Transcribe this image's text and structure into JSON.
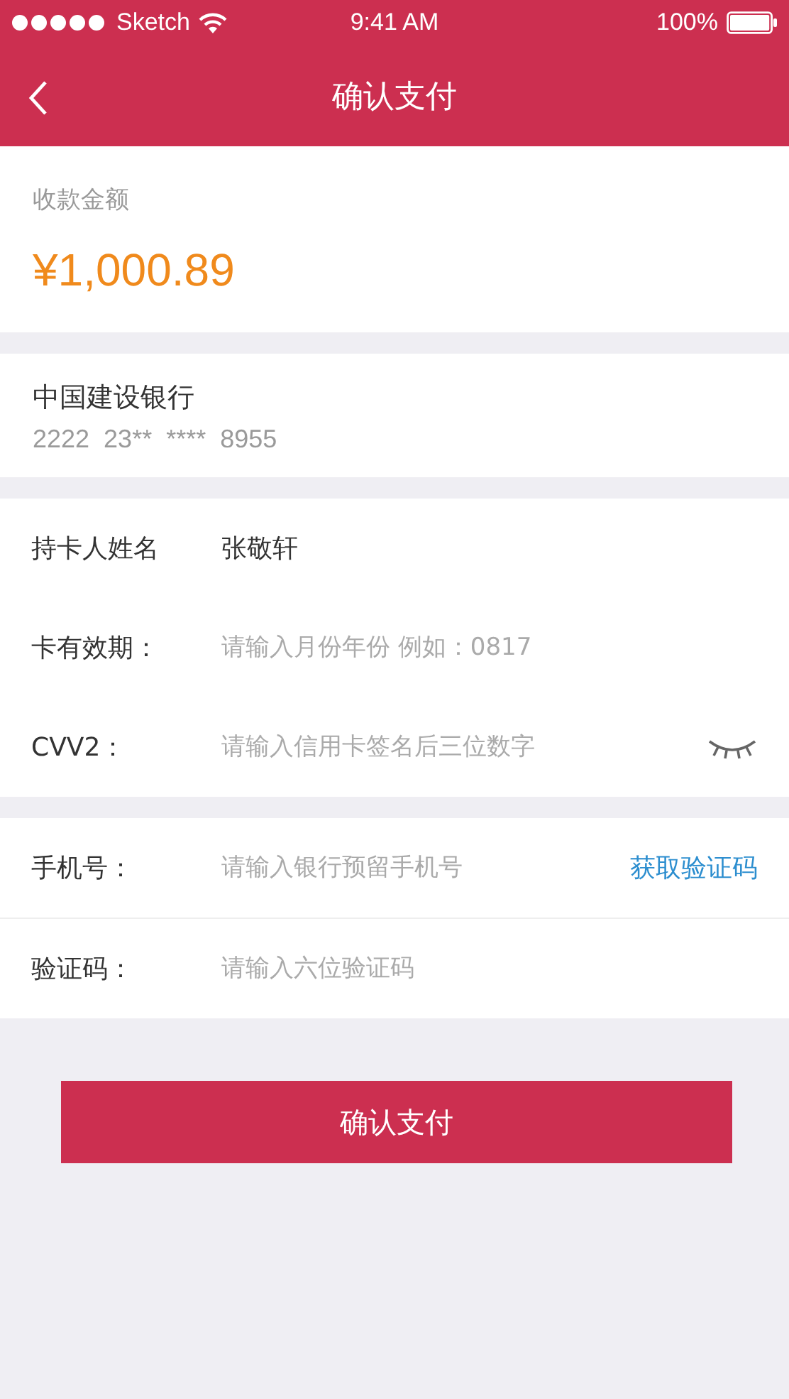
{
  "status_bar": {
    "carrier": "Sketch",
    "time": "9:41 AM",
    "battery": "100%"
  },
  "nav": {
    "title": "确认支付"
  },
  "amount": {
    "label": "收款金额",
    "value": "¥1,000.89"
  },
  "bank": {
    "name": "中国建设银行",
    "card_number": "2222  23**  ****  8955"
  },
  "sections": [
    {
      "rows": [
        {
          "kind": "text",
          "label": "持卡人姓名",
          "value": "张敬轩"
        },
        {
          "kind": "input",
          "label": "卡有效期：",
          "placeholder": "请输入月份年份 例如：0817"
        },
        {
          "kind": "input",
          "label": "CVV2：",
          "placeholder": "请输入信用卡签名后三位数字",
          "masked": true
        }
      ]
    },
    {
      "rows": [
        {
          "kind": "input",
          "label": "手机号：",
          "placeholder": "请输入银行预留手机号",
          "action": "获取验证码"
        },
        {
          "kind": "input",
          "label": "验证码：",
          "placeholder": "请输入六位验证码"
        }
      ]
    }
  ],
  "submit": "确认支付"
}
